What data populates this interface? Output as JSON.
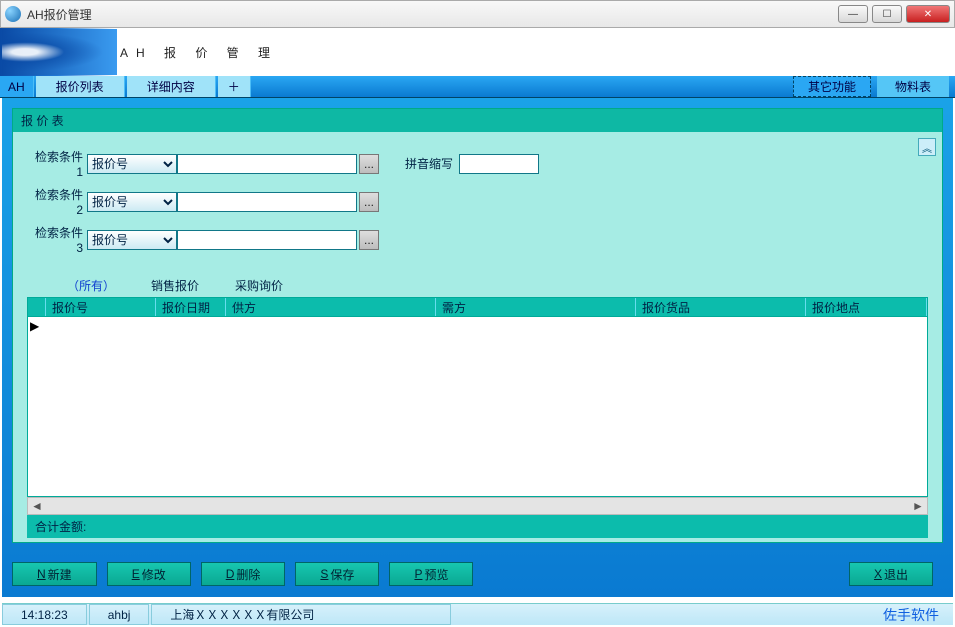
{
  "window": {
    "title": "AH报价管理"
  },
  "banner": {
    "title": "AH 报 价 管 理"
  },
  "tabs": {
    "ah": "AH",
    "list": "报价列表",
    "detail": "详细内容",
    "plus": "＋",
    "other": "其它功能",
    "material": "物料表"
  },
  "panel": {
    "title": "报 价 表",
    "search": {
      "label1": "检索条件1",
      "label2": "检索条件2",
      "label3": "检索条件3",
      "combo_value": "报价号",
      "dots": "...",
      "pinyin_label": "拼音缩写"
    },
    "subtabs": {
      "all": "（所有）",
      "sales": "销售报价",
      "purchase": "采购询价"
    },
    "columns": {
      "c1": "报价号",
      "c2": "报价日期",
      "c3": "供方",
      "c4": "需方",
      "c5": "报价货品",
      "c6": "报价地点"
    },
    "rowmarker": "▶",
    "total_label": "合计金额:"
  },
  "actions": {
    "new": {
      "u": "N",
      "t": " 新建"
    },
    "edit": {
      "u": "E",
      "t": " 修改"
    },
    "del": {
      "u": "D",
      "t": " 删除"
    },
    "save": {
      "u": "S",
      "t": " 保存"
    },
    "preview": {
      "u": "P",
      "t": " 预览"
    },
    "exit": {
      "u": "X",
      "t": " 退出"
    }
  },
  "status": {
    "time": "14:18:23",
    "code": "ahbj",
    "company": "上海ＸＸＸＸＸＸ有限公司",
    "brand": "佐手软件"
  },
  "glyphs": {
    "collapse": "︽",
    "left": "◄",
    "right": "►",
    "min": "—",
    "max": "☐",
    "close": "✕"
  }
}
